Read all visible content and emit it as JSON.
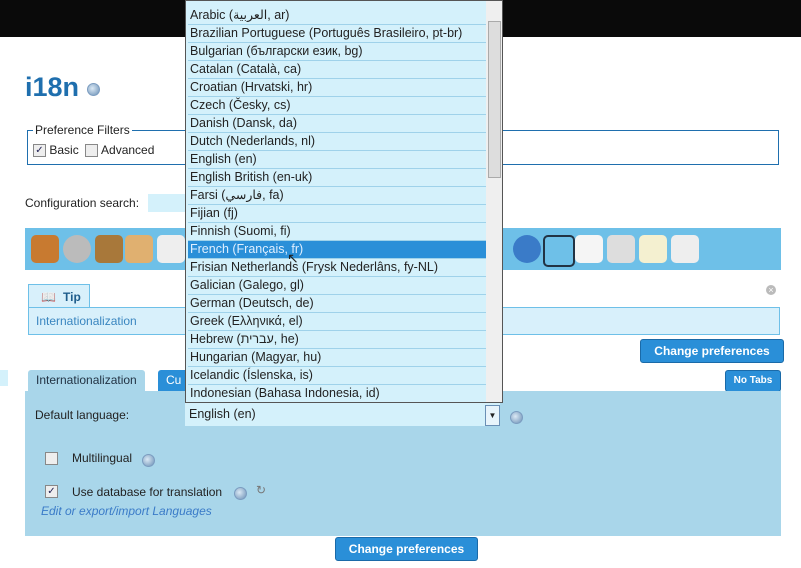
{
  "page": {
    "title": "i18n"
  },
  "filters": {
    "legend": "Preference Filters",
    "items": [
      {
        "label": "Basic",
        "checked": true
      },
      {
        "label": "Advanced",
        "checked": false
      }
    ]
  },
  "search": {
    "label": "Configuration search:",
    "value": ""
  },
  "tip": {
    "tab": "Tip",
    "text": "Internationalization"
  },
  "buttons": {
    "change_top": "Change preferences",
    "change_bottom": "Change preferences",
    "no_tabs": "No Tabs"
  },
  "tabs": [
    {
      "label": "Internationalization",
      "active": true
    },
    {
      "label": "Cu",
      "active": false
    }
  ],
  "form": {
    "default_language_label": "Default language:",
    "default_language_value": "English (en)",
    "multilingual_label": "Multilingual",
    "multilingual_checked": false,
    "use_db_label": "Use database for translation",
    "use_db_checked": true,
    "edit_link": "Edit or export/import Languages"
  },
  "dropdown": {
    "selected_index": 13,
    "options": [
      "Arabic (العربية, ar)",
      "Brazilian Portuguese (Português Brasileiro, pt-br)",
      "Bulgarian (български език, bg)",
      "Catalan (Català, ca)",
      "Croatian (Hrvatski, hr)",
      "Czech (Česky, cs)",
      "Danish (Dansk, da)",
      "Dutch (Nederlands, nl)",
      "English (en)",
      "English British (en-uk)",
      "Farsi (فارسي, fa)",
      "Fijian (fj)",
      "Finnish (Suomi, fi)",
      "French (Français, fr)",
      "Frisian Netherlands (Frysk Nederlâns, fy-NL)",
      "Galician (Galego, gl)",
      "German (Deutsch, de)",
      "Greek (Ελληνικά, el)",
      "Hebrew (עברית, he)",
      "Hungarian (Magyar, hu)",
      "Icelandic (Íslenska, is)",
      "Indonesian (Bahasa Indonesia, id)"
    ]
  },
  "colors": {
    "accent": "#2a8fd8",
    "panel": "#a9d6ea",
    "toolbar": "#6ec0e8"
  }
}
